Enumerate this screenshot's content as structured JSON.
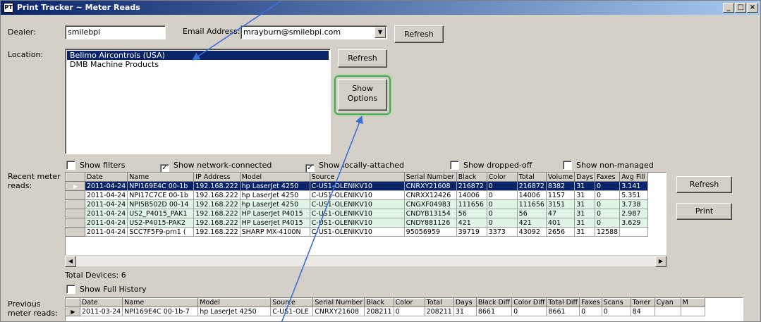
{
  "window": {
    "title": "Print Tracker ~ Meter Reads",
    "app_icon": "PT",
    "min": "_",
    "max": "□",
    "close": "×"
  },
  "dealer": {
    "label": "Dealer:",
    "value": "smilebpi"
  },
  "email": {
    "label": "Email Address:",
    "value": "mrayburn@smilebpi.com",
    "arrow": "▼"
  },
  "refresh_top": "Refresh",
  "location": {
    "label": "Location:",
    "items": [
      "Belimo Aircontrols (USA)",
      "DMB Machine Products"
    ]
  },
  "refresh_location": "Refresh",
  "show_options": {
    "line1": "Show",
    "line2": "Options"
  },
  "filters": {
    "show_filters": {
      "label": "Show filters",
      "checked": ""
    },
    "show_network": {
      "label": "Show network-connected",
      "checked": "✓"
    },
    "show_local": {
      "label": "Show locally-attached",
      "checked": "✓"
    },
    "show_dropped": {
      "label": "Show dropped-off",
      "checked": ""
    },
    "show_nonmanaged": {
      "label": "Show non-managed",
      "checked": ""
    }
  },
  "recent": {
    "label_line1": "Recent meter",
    "label_line2": "reads:",
    "columns": [
      "Date",
      "Name",
      "IP Address",
      "Model",
      "Source",
      "Serial Number",
      "Black",
      "Color",
      "Total",
      "Volume",
      "Days",
      "Faxes",
      "Avg Fill"
    ],
    "rows": [
      {
        "marker": "▶",
        "cells": [
          "2011-04-24",
          "NPI169E4C  00-1b",
          "192.168.222",
          "hp LaserJet 4250",
          "C-US1-OLENIKV10",
          "CNRXY21608",
          "216872",
          "0",
          "216872",
          "8382",
          "31",
          "0",
          "3.141"
        ]
      },
      {
        "marker": "",
        "cells": [
          "2011-04-24",
          "NPI17C7CE  00-1b",
          "192.168.222",
          "hp LaserJet 4250",
          "C-US1-OLENIKV10",
          "CNRXX12426",
          "14006",
          "0",
          "14006",
          "1157",
          "31",
          "0",
          "5.351"
        ]
      },
      {
        "marker": "",
        "cells": [
          "2011-04-24",
          "NPI5B502D  00-14",
          "192.168.222",
          "hp LaserJet 4250",
          "C-US1-OLENIKV10",
          "CNGXF04983",
          "111656",
          "0",
          "111656",
          "3151",
          "31",
          "0",
          "3.738"
        ]
      },
      {
        "marker": "",
        "cells": [
          "2011-04-24",
          "US2_P4015_PAK1",
          "192.168.222",
          "HP LaserJet P4015",
          "C-US1-OLENIKV10",
          "CNDYB13154",
          "56",
          "0",
          "56",
          "47",
          "31",
          "0",
          "2.987"
        ]
      },
      {
        "marker": "",
        "cells": [
          "2011-04-24",
          "US2-P4015-PAK2",
          "192.168.222",
          "HP LaserJet P4015",
          "C-US1-OLENIKV10",
          "CNDY881126",
          "421",
          "0",
          "421",
          "401",
          "31",
          "0",
          "3.629"
        ]
      },
      {
        "marker": "",
        "cells": [
          "2011-04-24",
          "SCC7F5F9-prn1  (",
          "192.168.222",
          "SHARP MX-4100N",
          "C-US1-OLENIKV10",
          "95056959",
          "39719",
          "3373",
          "43092",
          "2656",
          "31",
          "12588",
          ""
        ]
      }
    ]
  },
  "refresh_right": "Refresh",
  "print": "Print",
  "total_devices": "Total Devices: 6",
  "show_full_history": {
    "label": "Show Full History",
    "checked": ""
  },
  "previous": {
    "label_line1": "Previous",
    "label_line2": "meter reads:",
    "columns": [
      "Date",
      "Name",
      "Model",
      "Source",
      "Serial Number",
      "Black",
      "Color",
      "Total",
      "Days",
      "Black Diff",
      "Color Diff",
      "Total Diff",
      "Faxes",
      "Scans",
      "Toner",
      "Cyan",
      "M"
    ],
    "rows": [
      {
        "marker": "▶",
        "cells": [
          "2011-03-24",
          "NPI169E4C  00-1b-7",
          "hp LaserJet 4250",
          "C-US1-OLE",
          "CNRXY21608",
          "208211",
          "0",
          "208211",
          "31",
          "8661",
          "0",
          "8661",
          "0",
          "0",
          "84",
          "",
          ""
        ]
      }
    ]
  },
  "scroll": {
    "left": "◀",
    "right": "▶"
  },
  "colors": {
    "title_start": "#0a246a",
    "title_end": "#a6caf0",
    "selection": "#0a246a",
    "alt_row": "#e0f5e6",
    "annotation_arrow": "#3a6fd8",
    "highlight_ring": "#3db04a"
  }
}
